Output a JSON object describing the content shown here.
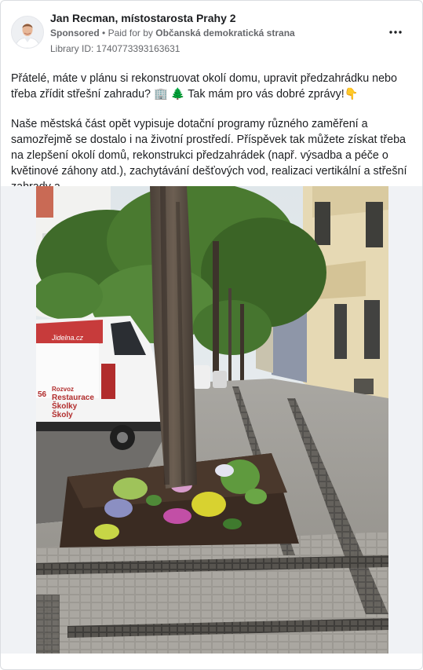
{
  "post": {
    "author_name": "Jan Recman, místostarosta Prahy 2",
    "sponsored_label": "Sponsored",
    "separator": "•",
    "paid_for_prefix": "Paid for by",
    "paid_for_org": "Občanská demokratická strana",
    "library_id": "Library ID: 1740773393163631",
    "more_icon": "more-horizontal-icon"
  },
  "body": {
    "paragraph1": "Přátelé, máte v plánu si rekonstruovat okolí domu, upravit předzahrádku nebo třeba zřídit střešní zahradu? 🏢 🌲 Tak mám pro vás dobré zprávy!👇",
    "paragraph2": "Naše městská část opět vypisuje dotační programy různého zaměření a samozřejmě se dostalo i na životní prostředí. Příspěvek tak můžete získat třeba na zlepšení okolí domů, rekonstrukci předzahrádek (např. výsadba a péče o květinové záhony atd.), zachytávání dešťových vod, realizaci vertikální a střešní zahrady a…"
  },
  "photo": {
    "van_text": {
      "line1": "Rozvoz",
      "line2": "Restaurace",
      "line3": "Školky",
      "line4": "Školy",
      "brand": "Jidelna.cz",
      "number_fragment": "56"
    }
  },
  "colors": {
    "text_primary": "#1c1e21",
    "text_secondary": "#65676b",
    "card_border": "#dadde1",
    "image_bg": "#f0f2f5"
  }
}
